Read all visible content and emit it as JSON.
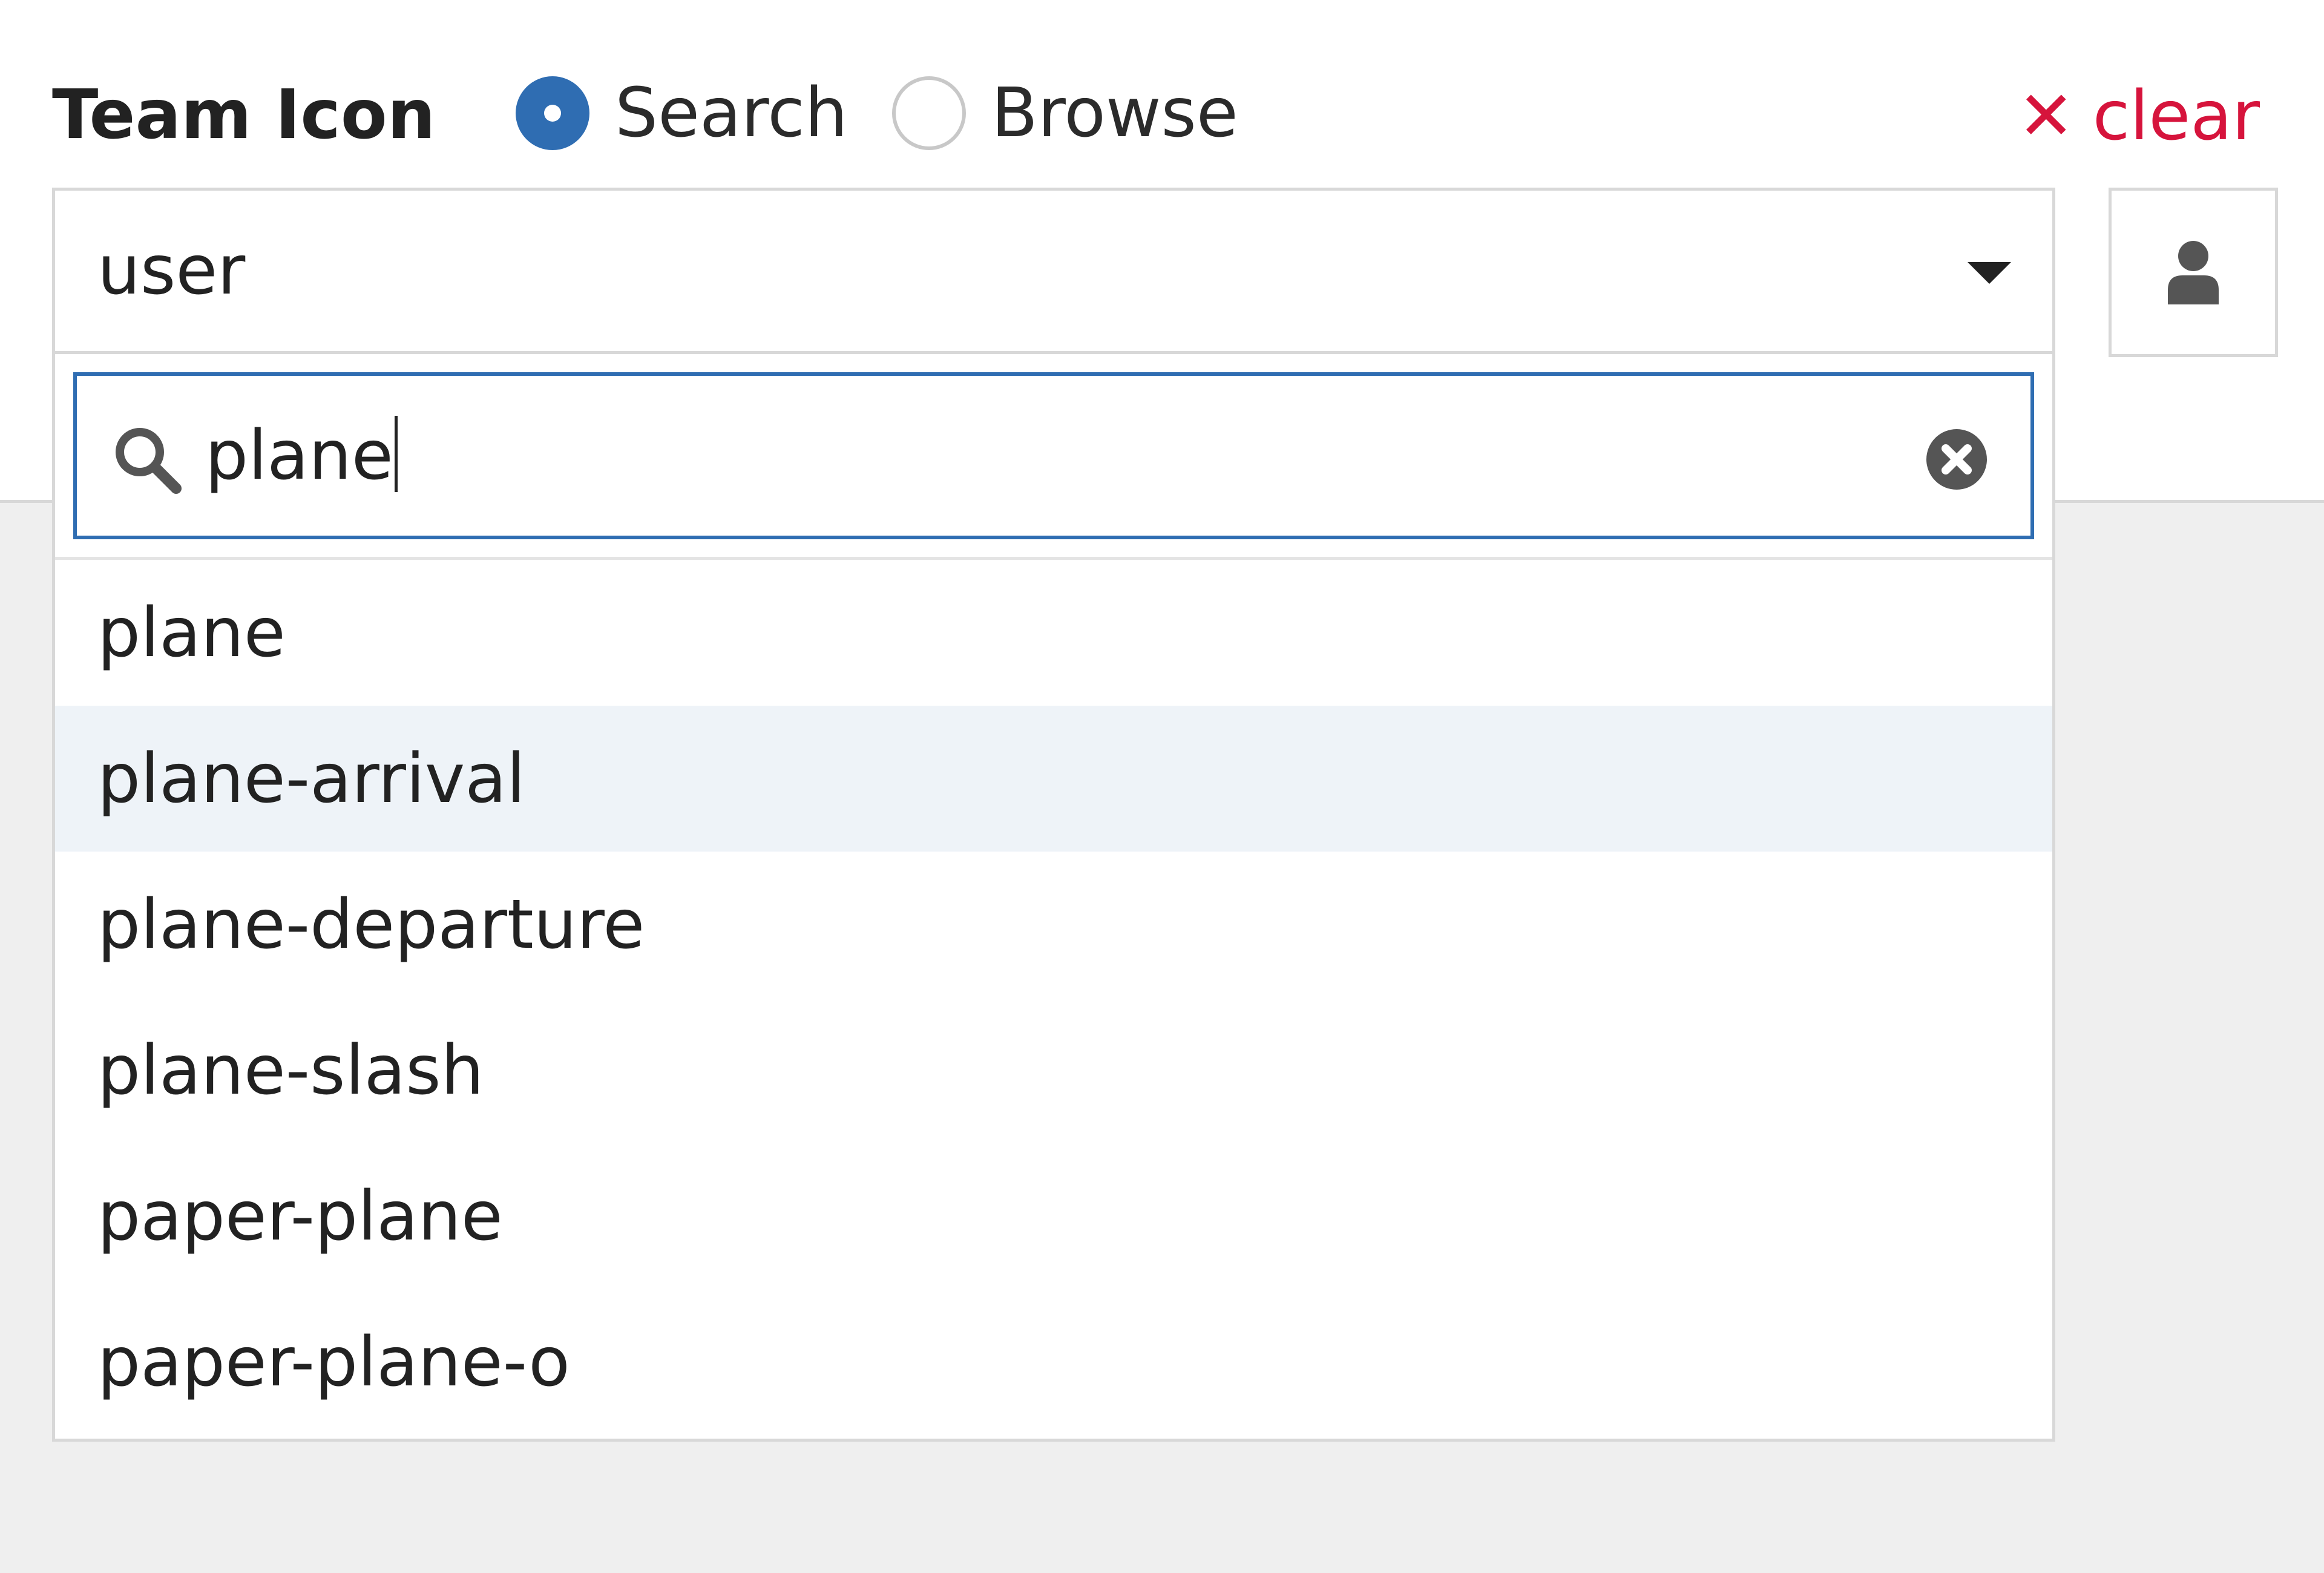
{
  "field": {
    "label": "Team Icon",
    "mode_options": [
      {
        "label": "Search",
        "checked": true
      },
      {
        "label": "Browse",
        "checked": false
      }
    ],
    "clear_label": "clear",
    "clear_icon": "x-icon",
    "accent_color": "#2f6db2",
    "clear_color": "#d6143c"
  },
  "select": {
    "value": "user",
    "preview_icon": "user-icon"
  },
  "dropdown": {
    "search_value": "plane",
    "search_icon": "search-icon",
    "clear_input_icon": "circle-x-icon",
    "highlighted_index": 1,
    "options": [
      "plane",
      "plane-arrival",
      "plane-departure",
      "plane-slash",
      "paper-plane",
      "paper-plane-o"
    ]
  }
}
